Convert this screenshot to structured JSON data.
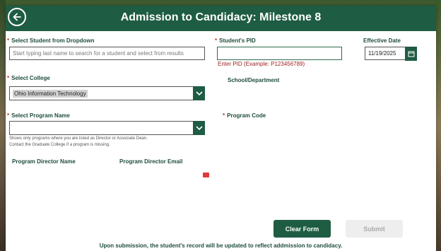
{
  "header": {
    "title": "Admission to Candidacy: Milestone 8"
  },
  "student": {
    "label": "Select Student from Dropdown",
    "placeholder": "Start typing last name to search for a student and select from results"
  },
  "pid": {
    "label": "Student's PID",
    "value": "",
    "error": "Enter PID (Example: P123456789)"
  },
  "effective_date": {
    "label": "Effective Date",
    "value": "11/19/2025"
  },
  "college": {
    "label": "Select College",
    "value": "Ohio Information Technology"
  },
  "school_department": {
    "label": "School/Department"
  },
  "program": {
    "label": "Select Program Name",
    "help_line1": "Shows only programs where you are listed as Director or Associate Dean.",
    "help_line2": "Contact the Graduate College if a program is missing."
  },
  "program_code": {
    "label": "Program Code"
  },
  "director_name": {
    "label": "Program Director Name"
  },
  "director_email": {
    "label": "Program Director Email"
  },
  "buttons": {
    "clear": "Clear Form",
    "submit": "Submit"
  },
  "footer": {
    "note": "Upon submission, the student's record will be updated to reflect addmission to candidacy."
  },
  "colors": {
    "header": "#1e5c43",
    "error": "#9b1c1c",
    "required": "#c0392b"
  },
  "icons": {
    "back": "arrow-left-circle-icon",
    "dropdown": "chevron-down-icon",
    "calendar": "calendar-icon",
    "error": "error-icon"
  }
}
